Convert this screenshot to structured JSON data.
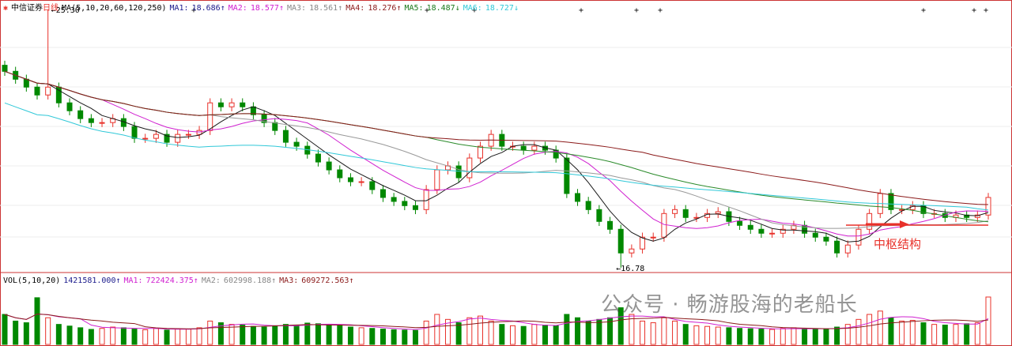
{
  "header": {
    "symbol": "中信证券",
    "period": "日线",
    "ma_label": "MA(5,10,20,60,120,250)",
    "ma": [
      {
        "label": "MA1:",
        "value": "18.686↑",
        "color": "#1a1a8c"
      },
      {
        "label": "MA2:",
        "value": "18.577↑",
        "color": "#d020d0"
      },
      {
        "label": "MA3:",
        "value": "18.561↑",
        "color": "#888888"
      },
      {
        "label": "MA4:",
        "value": "18.276↑",
        "color": "#8b1a1a"
      },
      {
        "label": "MA5:",
        "value": "18.487↓",
        "color": "#1a7a1a"
      },
      {
        "label": "MA6:",
        "value": "18.727↓",
        "color": "#30c8d8"
      }
    ]
  },
  "volume_header": {
    "label": "VOL(5,10,20)",
    "value": "1421581.000↑",
    "ma": [
      {
        "label": "MA1:",
        "value": "722424.375↑",
        "color": "#d020d0"
      },
      {
        "label": "MA2:",
        "value": "602998.188↑",
        "color": "#888888"
      },
      {
        "label": "MA3:",
        "value": "609272.563↑",
        "color": "#8b1a1a"
      }
    ]
  },
  "annotation": "中枢结构",
  "watermark": "公众号 · 畅游股海的老船长",
  "colors": {
    "up": "#e8312a",
    "down": "#008800",
    "ma5": "#1a1a1a",
    "ma10": "#d020d0",
    "ma20": "#999999",
    "ma60": "#2a8a2a",
    "ma120": "#8b1a1a",
    "ma250": "#30c8d8"
  },
  "chart_data": {
    "type": "candlestick",
    "ylim": [
      16.5,
      25.6
    ],
    "max_label": "25.30",
    "min_label": "16.78",
    "closes": [
      23.26,
      23.0,
      22.74,
      22.48,
      22.74,
      22.22,
      21.96,
      21.7,
      21.57,
      21.57,
      21.7,
      21.44,
      21.05,
      21.05,
      21.18,
      20.92,
      21.18,
      21.18,
      21.31,
      22.22,
      22.09,
      22.22,
      22.09,
      21.83,
      21.57,
      21.31,
      20.92,
      20.79,
      20.53,
      20.27,
      20.01,
      19.75,
      19.62,
      19.62,
      19.36,
      19.1,
      18.97,
      18.83,
      18.7,
      19.36,
      20.01,
      20.14,
      19.75,
      20.4,
      20.79,
      21.18,
      20.79,
      20.79,
      20.66,
      20.79,
      20.66,
      20.4,
      19.23,
      18.97,
      18.7,
      18.31,
      18.05,
      17.27,
      17.4,
      17.79,
      17.79,
      18.57,
      18.7,
      18.44,
      18.44,
      18.57,
      18.63,
      18.31,
      18.18,
      18.05,
      17.92,
      17.92,
      18.05,
      18.18,
      17.92,
      17.79,
      17.66,
      17.27,
      17.53,
      18.05,
      18.57,
      19.23,
      18.7,
      18.7,
      18.83,
      18.57,
      18.57,
      18.44,
      18.52,
      18.44,
      18.52,
      19.1
    ],
    "volumes": [
      900,
      700,
      650,
      1400,
      800,
      600,
      550,
      500,
      450,
      480,
      520,
      500,
      460,
      440,
      480,
      430,
      470,
      460,
      500,
      700,
      650,
      600,
      580,
      540,
      520,
      560,
      600,
      580,
      640,
      620,
      600,
      560,
      520,
      500,
      480,
      460,
      440,
      430,
      420,
      700,
      900,
      750,
      650,
      800,
      850,
      700,
      600,
      560,
      540,
      600,
      580,
      560,
      900,
      800,
      700,
      750,
      800,
      1100,
      900,
      700,
      650,
      800,
      700,
      600,
      560,
      540,
      520,
      500,
      480,
      470,
      460,
      450,
      480,
      500,
      470,
      460,
      450,
      520,
      600,
      750,
      900,
      1000,
      800,
      700,
      720,
      650,
      600,
      580,
      600,
      620,
      650,
      1421
    ]
  }
}
